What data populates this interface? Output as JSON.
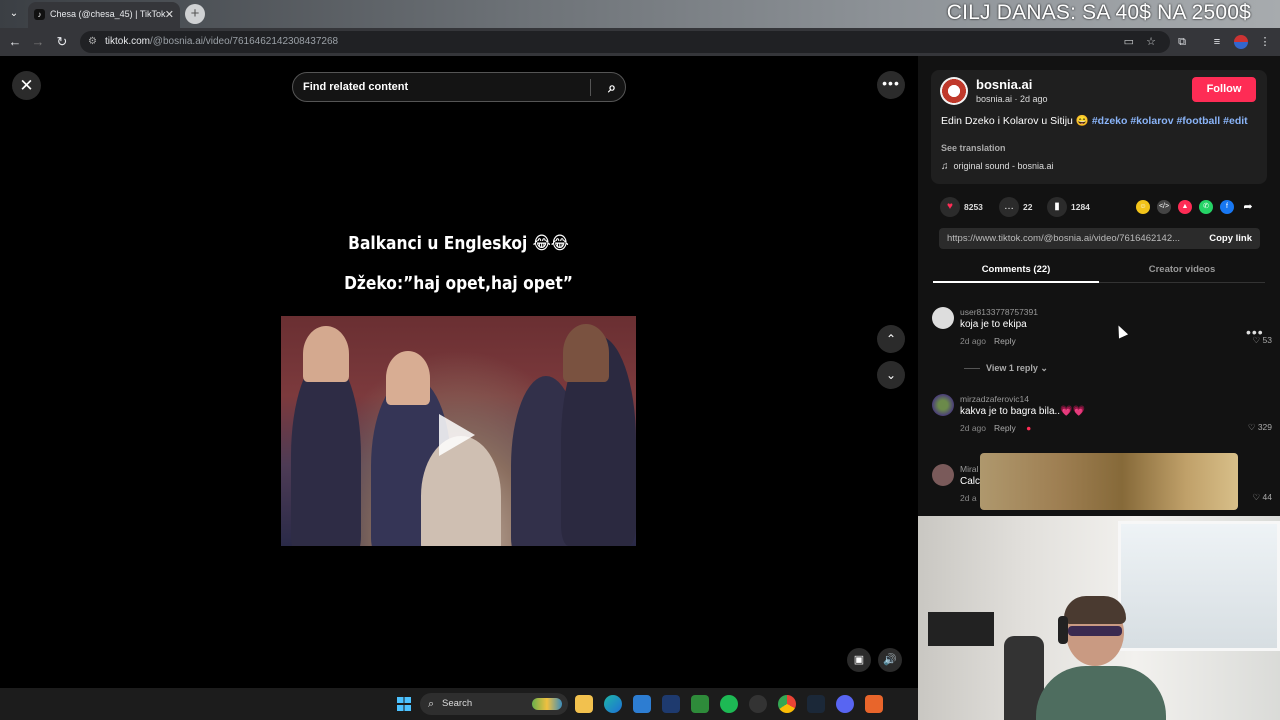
{
  "browser": {
    "tab_title": "Chesa (@chesa_45) | TikTok",
    "url_host": "tiktok.com",
    "url_path": "/@bosnia.ai/video/7616462142308437268"
  },
  "stream_overlay": {
    "goal_text": "CILJ DANAS: SA 40$ NA 2500$"
  },
  "search": {
    "placeholder": "Find related content"
  },
  "video": {
    "caption_line1": "Balkanci u Engleskoj 😂😂",
    "caption_line2": "Džeko:”haj opet,haj opet”"
  },
  "author": {
    "name": "bosnia.ai",
    "handle": "bosnia.ai",
    "age": "2d ago",
    "follow_label": "Follow",
    "description_prefix": "Edin Dzeko i Kolarov u Sitiju 😄",
    "hashtags": [
      "#dzeko",
      "#kolarov",
      "#football",
      "#edit"
    ],
    "see_translation": "See translation",
    "sound": "original sound - bosnia.ai"
  },
  "stats": {
    "likes": "8253",
    "comments": "22",
    "saves": "1284"
  },
  "link": {
    "url": "https://www.tiktok.com/@bosnia.ai/video/7616462142...",
    "copy_label": "Copy link"
  },
  "tabs": {
    "comments": "Comments (22)",
    "creator_videos": "Creator videos"
  },
  "comments": [
    {
      "user": "user8133778757391",
      "text": "koja je to ekipa",
      "age": "2d ago",
      "reply": "Reply",
      "likes": "53"
    },
    {
      "user": "mirzadzaferovic14",
      "text": "kakva je to bagra bila..💗💗",
      "age": "2d ago",
      "reply": "Reply",
      "likes": "329"
    },
    {
      "user": "Miral",
      "text": "Calc",
      "age": "2d a",
      "reply": "",
      "likes": "44"
    }
  ],
  "view_reply": "View 1 reply",
  "taskbar": {
    "search_label": "Search"
  },
  "colors": {
    "accent": "#fe2c55",
    "hashtag": "#8ab4f8",
    "background": "#000000"
  }
}
